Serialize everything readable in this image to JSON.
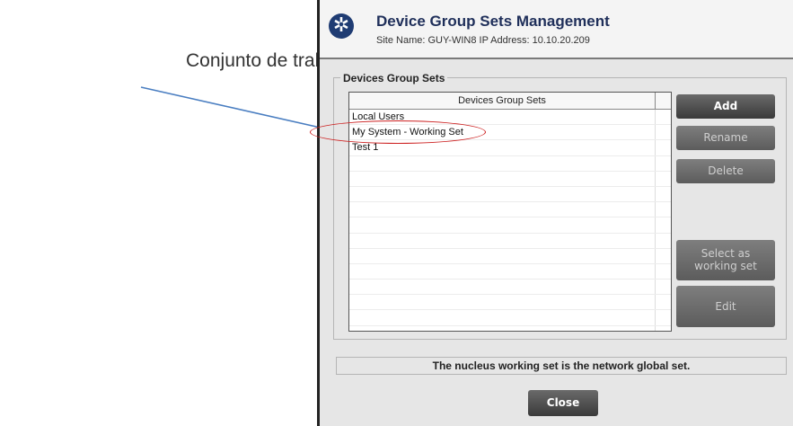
{
  "callout": {
    "text": "Conjunto de trabajo"
  },
  "window": {
    "title": "Device Group Sets Management",
    "subtitle": "Site Name: GUY-WIN8   IP Address: 10.10.20.209",
    "logo_icon": "nucleus-logo-icon"
  },
  "group": {
    "label": "Devices Group Sets",
    "column_header": "Devices Group Sets",
    "items": [
      "Local Users",
      "My System - Working Set",
      "Test 1",
      "",
      "",
      "",
      "",
      "",
      "",
      "",
      "",
      "",
      "",
      "",
      ""
    ]
  },
  "buttons": {
    "add": "Add",
    "rename": "Rename",
    "delete": "Delete",
    "select_line1": "Select as",
    "select_line2": "working set",
    "edit": "Edit"
  },
  "status": "The nucleus working set is the network global set.",
  "close": "Close",
  "colors": {
    "annotation_arrow": "#4a7ec1",
    "highlight_oval": "#cc2020",
    "title": "#1f2f5a"
  }
}
